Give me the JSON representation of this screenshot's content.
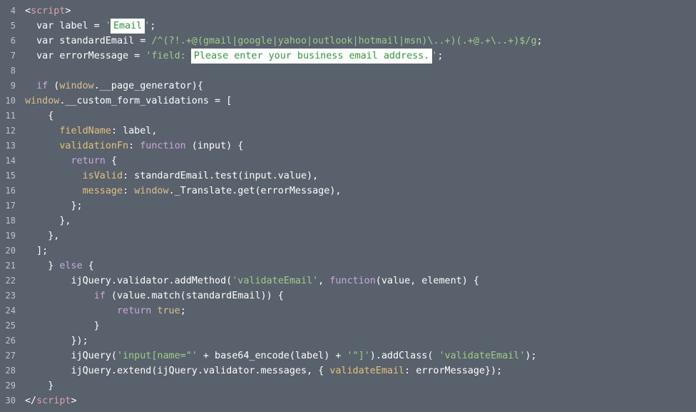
{
  "code": {
    "line_numbers": [
      "4",
      "5",
      "6",
      "7",
      "8",
      "9",
      "10",
      "11",
      "12",
      "13",
      "14",
      "15",
      "16",
      "17",
      "18",
      "19",
      "20",
      "21",
      "22",
      "23",
      "24",
      "25",
      "26",
      "27",
      "28",
      "29",
      "30"
    ],
    "lines": [
      {
        "indent": "",
        "tokens": [
          [
            "tag",
            "<"
          ],
          [
            "tagname",
            "script"
          ],
          [
            "tag",
            ">"
          ]
        ]
      },
      {
        "indent": "  ",
        "tokens": [
          [
            "plain",
            "var label = "
          ],
          [
            "str",
            "'"
          ],
          [
            "hl",
            "Email"
          ],
          [
            "str",
            "'"
          ],
          [
            "plain",
            ";"
          ]
        ]
      },
      {
        "indent": "  ",
        "tokens": [
          [
            "plain",
            "var standardEmail = "
          ],
          [
            "str",
            "/^(?!.+@(gmail|google|yahoo|outlook|hotmail|msn)\\..+)(.+@.+\\..+)$/g"
          ],
          [
            "plain",
            ";"
          ]
        ]
      },
      {
        "indent": "  ",
        "tokens": [
          [
            "plain",
            "var errorMessage = "
          ],
          [
            "str",
            "'field: "
          ],
          [
            "hl",
            "Please enter your business email address."
          ],
          [
            "str",
            "'"
          ],
          [
            "plain",
            ";"
          ]
        ]
      },
      {
        "indent": "",
        "tokens": []
      },
      {
        "indent": "  ",
        "tokens": [
          [
            "kw",
            "if"
          ],
          [
            "plain",
            " ("
          ],
          [
            "glob",
            "window"
          ],
          [
            "plain",
            ".__page_generator){"
          ]
        ]
      },
      {
        "indent": "",
        "tokens": [
          [
            "glob",
            "window"
          ],
          [
            "plain",
            ".__custom_form_validations = ["
          ]
        ]
      },
      {
        "indent": "    ",
        "tokens": [
          [
            "plain",
            "{"
          ]
        ]
      },
      {
        "indent": "      ",
        "tokens": [
          [
            "prop",
            "fieldName"
          ],
          [
            "plain",
            ": label,"
          ]
        ]
      },
      {
        "indent": "      ",
        "tokens": [
          [
            "prop",
            "validationFn"
          ],
          [
            "plain",
            ": "
          ],
          [
            "kw",
            "function"
          ],
          [
            "plain",
            " (input) {"
          ]
        ]
      },
      {
        "indent": "        ",
        "tokens": [
          [
            "kw",
            "return"
          ],
          [
            "plain",
            " {"
          ]
        ]
      },
      {
        "indent": "          ",
        "tokens": [
          [
            "prop",
            "isValid"
          ],
          [
            "plain",
            ": standardEmail.test(input.value),"
          ]
        ]
      },
      {
        "indent": "          ",
        "tokens": [
          [
            "prop",
            "message"
          ],
          [
            "plain",
            ": "
          ],
          [
            "glob",
            "window"
          ],
          [
            "plain",
            "._Translate.get(errorMessage),"
          ]
        ]
      },
      {
        "indent": "        ",
        "tokens": [
          [
            "plain",
            "};"
          ]
        ]
      },
      {
        "indent": "      ",
        "tokens": [
          [
            "plain",
            "},"
          ]
        ]
      },
      {
        "indent": "    ",
        "tokens": [
          [
            "plain",
            "},"
          ]
        ]
      },
      {
        "indent": "  ",
        "tokens": [
          [
            "plain",
            "];"
          ]
        ]
      },
      {
        "indent": "    ",
        "tokens": [
          [
            "plain",
            "} "
          ],
          [
            "kw",
            "else"
          ],
          [
            "plain",
            " {"
          ]
        ]
      },
      {
        "indent": "        ",
        "tokens": [
          [
            "plain",
            "ijQuery.validator.addMethod("
          ],
          [
            "str",
            "'validateEmail'"
          ],
          [
            "plain",
            ", "
          ],
          [
            "kw",
            "function"
          ],
          [
            "plain",
            "(value, element) {"
          ]
        ]
      },
      {
        "indent": "            ",
        "tokens": [
          [
            "kw",
            "if"
          ],
          [
            "plain",
            " (value.match(standardEmail)) {"
          ]
        ]
      },
      {
        "indent": "                ",
        "tokens": [
          [
            "kw",
            "return"
          ],
          [
            "plain",
            " "
          ],
          [
            "glob",
            "true"
          ],
          [
            "plain",
            ";"
          ]
        ]
      },
      {
        "indent": "            ",
        "tokens": [
          [
            "plain",
            "}"
          ]
        ]
      },
      {
        "indent": "        ",
        "tokens": [
          [
            "plain",
            "});"
          ]
        ]
      },
      {
        "indent": "        ",
        "tokens": [
          [
            "plain",
            "ijQuery("
          ],
          [
            "str",
            "'input[name=\"'"
          ],
          [
            "plain",
            " + base64_encode(label) + "
          ],
          [
            "str",
            "'\"]'"
          ],
          [
            "plain",
            ").addClass( "
          ],
          [
            "str",
            "'validateEmail'"
          ],
          [
            "plain",
            ");"
          ]
        ]
      },
      {
        "indent": "        ",
        "tokens": [
          [
            "plain",
            "ijQuery.extend(ijQuery.validator.messages, { "
          ],
          [
            "prop",
            "validateEmail"
          ],
          [
            "plain",
            ": errorMessage});"
          ]
        ]
      },
      {
        "indent": "    ",
        "tokens": [
          [
            "plain",
            "}"
          ]
        ]
      },
      {
        "indent": "",
        "tokens": [
          [
            "tag",
            "</"
          ],
          [
            "tagname",
            "script"
          ],
          [
            "tag",
            ">"
          ]
        ]
      }
    ]
  },
  "colors": {
    "background": "#59616c",
    "line_number": "#bfc4ca",
    "keyword": "#c9a7dc",
    "string": "#9fcc8a",
    "highlight_bg": "#ffffff",
    "highlight_text": "#2f9a3c"
  }
}
